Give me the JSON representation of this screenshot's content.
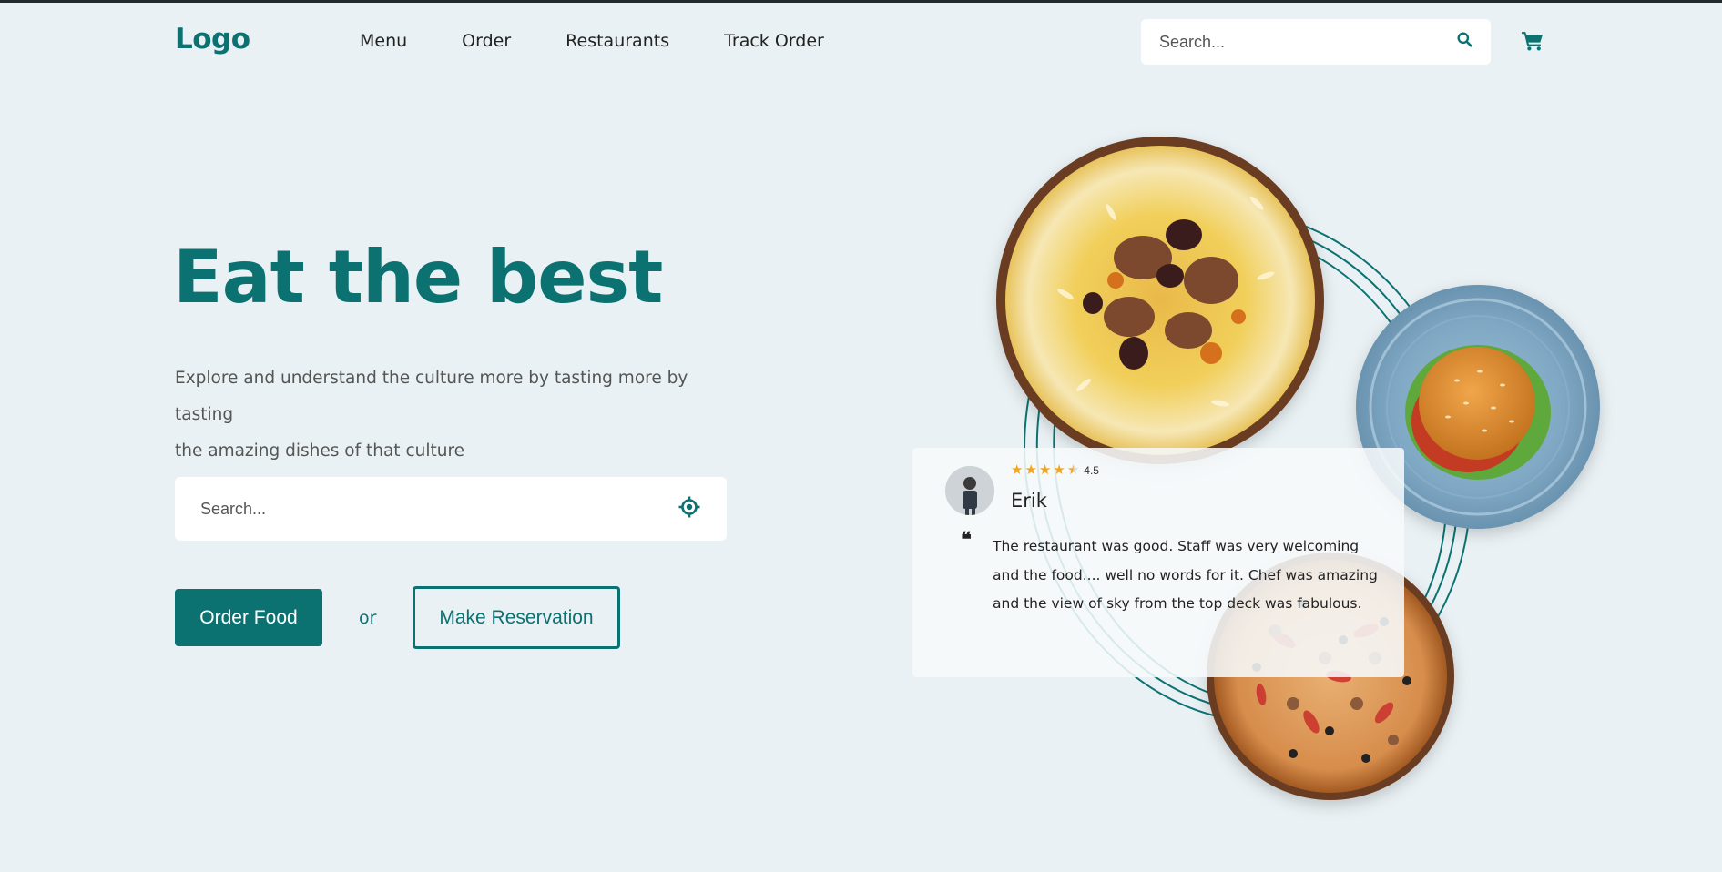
{
  "header": {
    "logo": "Logo",
    "nav": [
      "Menu",
      "Order",
      "Restaurants",
      "Track Order"
    ],
    "search_placeholder": "Search..."
  },
  "hero": {
    "title": "Eat the best",
    "subtitle_line1": "Explore and understand the culture more by tasting more by tasting",
    "subtitle_line2": "the amazing dishes of that culture",
    "search_placeholder": "Search...",
    "order_button": "Order Food",
    "or_text": "or",
    "reservation_button": "Make Reservation"
  },
  "review": {
    "rating": "4.5",
    "stars": 4.5,
    "name": "Erik",
    "text": "The restaurant was good. Staff was very welcoming and the food.... well no words for it. Chef was amazing and the view of sky from the top deck was fabulous."
  },
  "colors": {
    "accent": "#0b7271",
    "background": "#e9f1f4",
    "star": "#f3a522"
  }
}
